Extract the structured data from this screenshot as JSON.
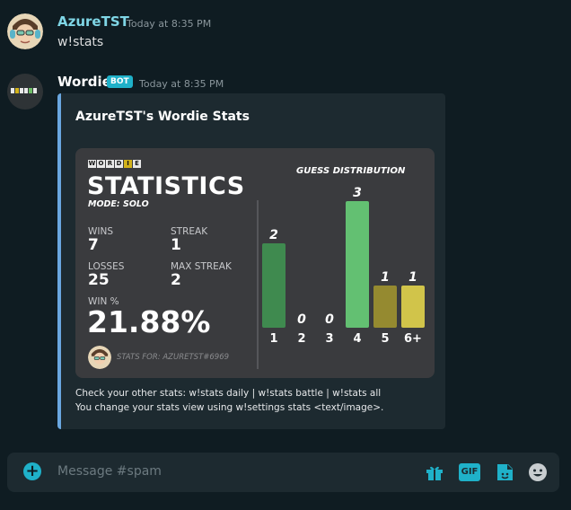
{
  "messages": [
    {
      "username": "AzureTST",
      "timestamp": "Today at 8:35 PM",
      "text": "w!stats"
    },
    {
      "username": "Wordie",
      "bot_tag": "BOT",
      "timestamp": "Today at 8:35 PM"
    }
  ],
  "embed": {
    "title": "AzureTST's Wordie Stats",
    "card": {
      "logo_letters": [
        "W",
        "O",
        "R",
        "D",
        "I",
        "E"
      ],
      "heading": "STATISTICS",
      "mode": "MODE: SOLO",
      "wins_label": "WINS",
      "wins": "7",
      "streak_label": "STREAK",
      "streak": "1",
      "losses_label": "LOSSES",
      "losses": "25",
      "max_streak_label": "MAX STREAK",
      "max_streak": "2",
      "winpct_label": "WIN %",
      "winpct": "21.88%",
      "stats_for": "STATS FOR: AZURETST#6969"
    },
    "footer_line1": "Check your other stats: w!stats daily | w!stats battle | w!stats all",
    "footer_line2": "You change your stats view using w!settings stats <text/image>."
  },
  "chart_data": {
    "type": "bar",
    "title": "GUESS DISTRIBUTION",
    "categories": [
      "1",
      "2",
      "3",
      "4",
      "5",
      "6+"
    ],
    "values": [
      2,
      0,
      0,
      3,
      1,
      1
    ],
    "colors": [
      "#3f8a4f",
      "#3f8a4f",
      "#3f8a4f",
      "#63c072",
      "#958a30",
      "#d1c44a"
    ],
    "ylim": [
      0,
      3
    ]
  },
  "composer": {
    "placeholder": "Message #spam",
    "icons": [
      "add-circle-icon",
      "gift-icon",
      "gif-icon",
      "sticker-icon",
      "emoji-icon"
    ],
    "gif_label": "GIF"
  },
  "colors": {
    "accent": "#1fb1c9",
    "username_azure": "#7fd6e6",
    "embed_border": "#6aa7e0"
  }
}
